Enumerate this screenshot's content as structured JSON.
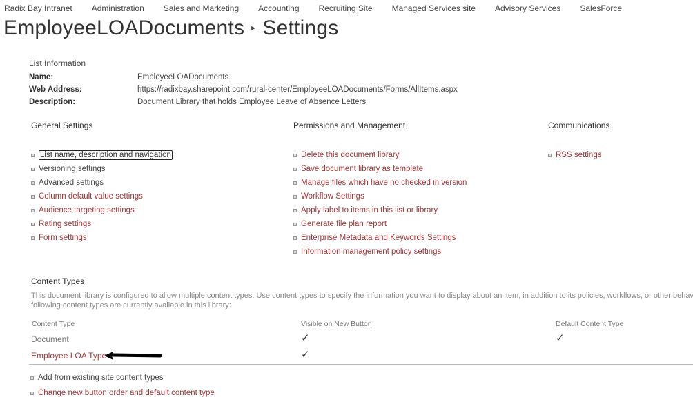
{
  "topnav": [
    "Radix Bay Intranet",
    "Administration",
    "Sales and Marketing",
    "Accounting",
    "Recruiting Site",
    "Managed Services site",
    "Advisory Services",
    "SalesForce"
  ],
  "title": {
    "list_name": "EmployeeLOADocuments",
    "separator_icon": "triangle-right",
    "page": "Settings"
  },
  "list_info": {
    "heading": "List Information",
    "name_label": "Name:",
    "name_value": "EmployeeLOADocuments",
    "address_label": "Web Address:",
    "address_value": "https://radixbay.sharepoint.com/rural-center/EmployeeLOADocuments/Forms/AllItems.aspx",
    "description_label": "Description:",
    "description_value": "Document Library that holds Employee Leave of Absence Letters"
  },
  "general_settings": {
    "heading": "General Settings",
    "links": [
      "List name, description and navigation",
      "Versioning settings",
      "Advanced settings",
      "Column default value settings",
      "Audience targeting settings",
      "Rating settings",
      "Form settings"
    ]
  },
  "permissions": {
    "heading": "Permissions and Management",
    "links": [
      "Delete this document library",
      "Save document library as template",
      "Manage files which have no checked in version",
      "Workflow Settings",
      "Apply label to items in this list or library",
      "Generate file plan report",
      "Enterprise Metadata and Keywords Settings",
      "Information management policy settings"
    ]
  },
  "communications": {
    "heading": "Communications",
    "links": [
      "RSS settings"
    ]
  },
  "content_types": {
    "heading": "Content Types",
    "description": "This document library is configured to allow multiple content types. Use content types to specify the information you want to display about an item, in addition to its policies, workflows, or other behavior. The following content types are currently available in this library:",
    "columns": [
      "Content Type",
      "Visible on New Button",
      "Default Content Type"
    ],
    "rows": [
      {
        "name": "Document",
        "visible": true,
        "default": true
      },
      {
        "name": "Employee LOA Type",
        "visible": true,
        "default": false
      }
    ],
    "check_glyph": "✓",
    "links": [
      "Add from existing site content types",
      "Change new button order and default content type"
    ]
  },
  "colors": {
    "link": "#a4373a",
    "text": "#444444",
    "muted": "#888888"
  }
}
